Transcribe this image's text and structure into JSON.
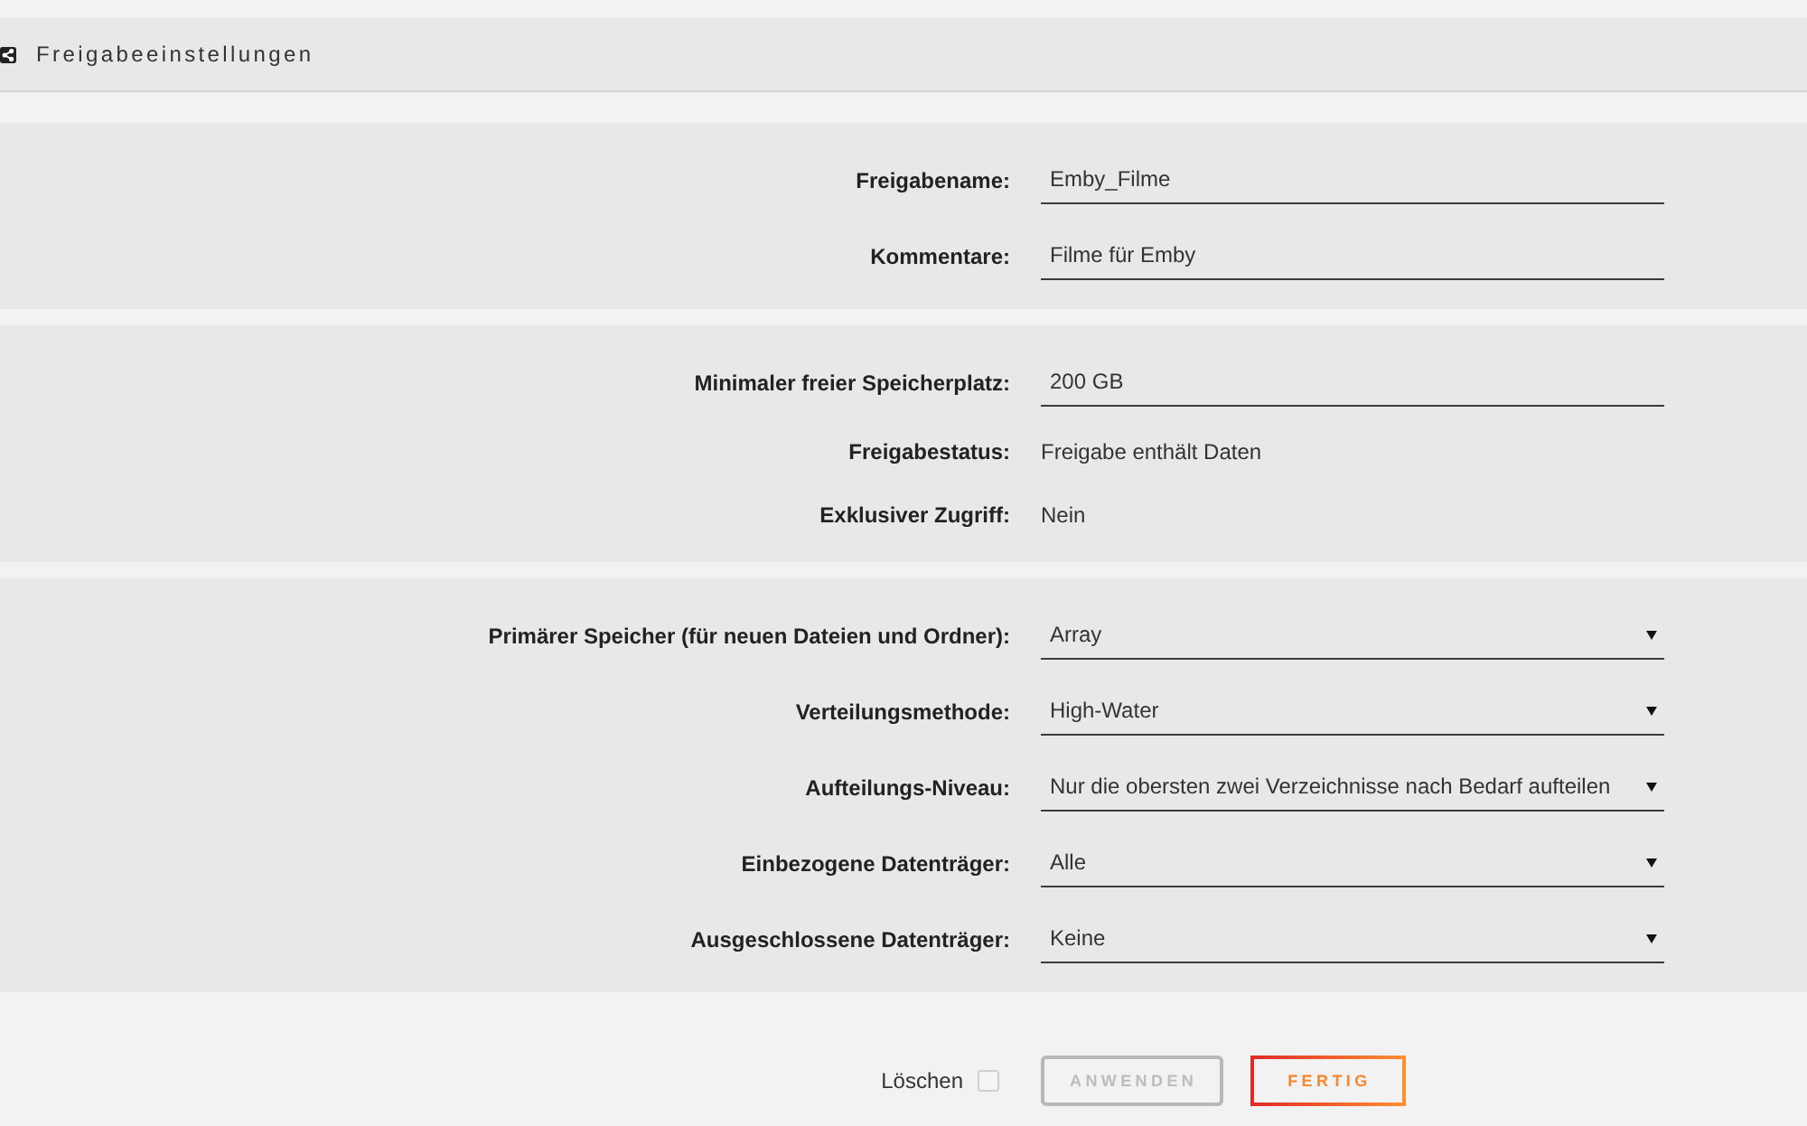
{
  "header": {
    "title": "Freigabeeinstellungen"
  },
  "sections": [
    {
      "rows": [
        {
          "kind": "input",
          "label": "Freigabename:",
          "value": "Emby_Filme"
        },
        {
          "kind": "input",
          "label": "Kommentare:",
          "value": "Filme für Emby"
        }
      ]
    },
    {
      "rows": [
        {
          "kind": "input",
          "label": "Minimaler freier Speicherplatz:",
          "value": "200 GB"
        },
        {
          "kind": "text",
          "label": "Freigabestatus:",
          "value": "Freigabe enthält Daten"
        },
        {
          "kind": "text",
          "label": "Exklusiver Zugriff:",
          "value": "Nein"
        }
      ]
    },
    {
      "rows": [
        {
          "kind": "select",
          "label": "Primärer Speicher (für neuen Dateien und Ordner):",
          "value": "Array"
        },
        {
          "kind": "select",
          "label": "Verteilungsmethode:",
          "value": "High-Water"
        },
        {
          "kind": "select",
          "label": "Aufteilungs-Niveau:",
          "value": "Nur die obersten zwei Verzeichnisse nach Bedarf aufteilen"
        },
        {
          "kind": "select",
          "label": "Einbezogene Datenträger:",
          "value": "Alle"
        },
        {
          "kind": "select",
          "label": "Ausgeschlossene Datenträger:",
          "value": "Keine"
        }
      ]
    }
  ],
  "footer": {
    "delete": {
      "label": "Löschen",
      "checked": false
    },
    "buttons": [
      {
        "label": "ANWENDEN",
        "disabled": true
      },
      {
        "label": "FERTIG",
        "disabled": false
      }
    ]
  }
}
